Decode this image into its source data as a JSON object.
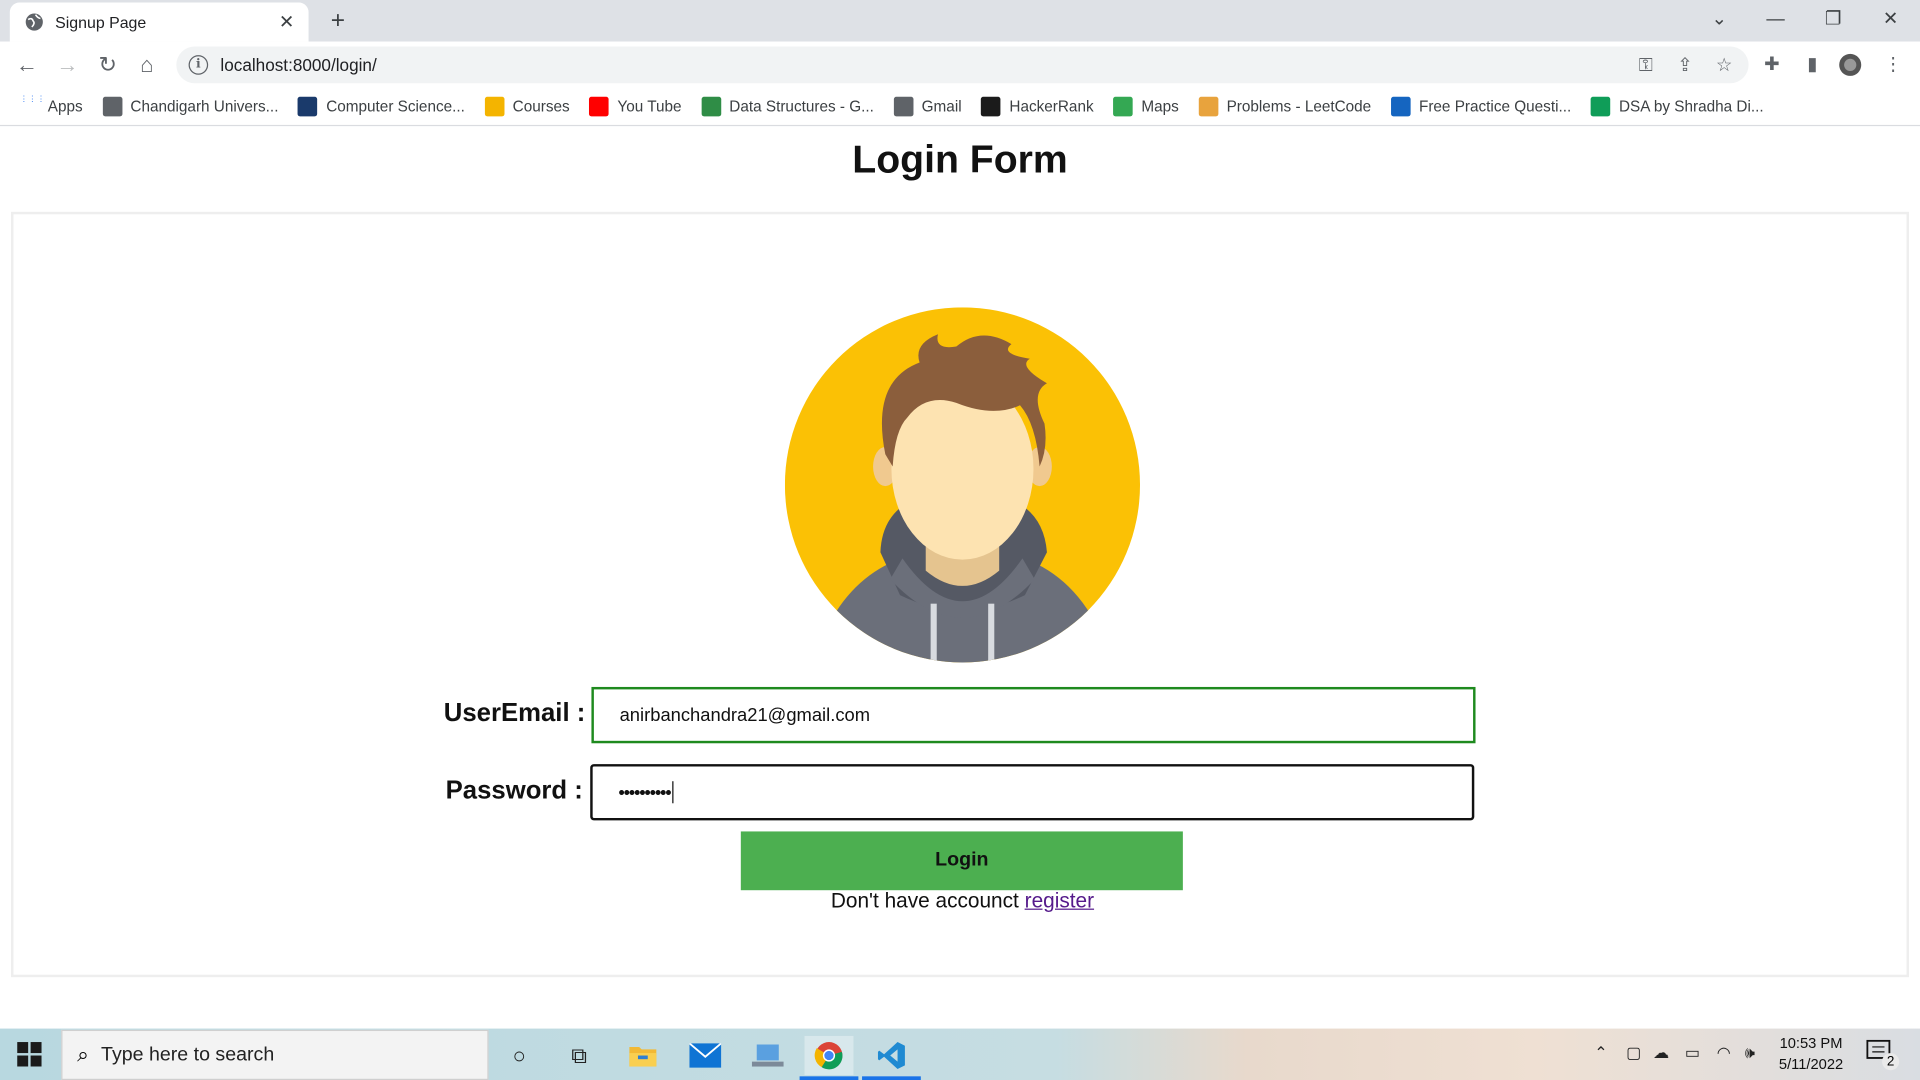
{
  "browser": {
    "tab_title": "Signup Page",
    "url": "localhost:8000/login/",
    "bookmarks": [
      {
        "label": "Apps",
        "color": "#4285f4"
      },
      {
        "label": "Chandigarh Univers...",
        "color": "#5f6368"
      },
      {
        "label": "Computer Science...",
        "color": "#1a3a6b"
      },
      {
        "label": "Courses",
        "color": "#f4b400"
      },
      {
        "label": "You Tube",
        "color": "#ff0000"
      },
      {
        "label": "Data Structures - G...",
        "color": "#2f8d46"
      },
      {
        "label": "Gmail",
        "color": "#5f6368"
      },
      {
        "label": "HackerRank",
        "color": "#1b1b1b"
      },
      {
        "label": "Maps",
        "color": "#34a853"
      },
      {
        "label": "Problems - LeetCode",
        "color": "#e8a33d"
      },
      {
        "label": "Free Practice Questi...",
        "color": "#1565c0"
      },
      {
        "label": "DSA by Shradha Di...",
        "color": "#0f9d58"
      }
    ]
  },
  "page": {
    "title": "Login Form",
    "email_label": "UserEmail :",
    "email_value": "anirbanchandra21@gmail.com",
    "password_label": "Password :",
    "password_value": "••••••••••",
    "login_label": "Login",
    "register_prompt": "Don't have accounct",
    "register_link": "register",
    "button_color": "#4caf50"
  },
  "taskbar": {
    "search_placeholder": "Type here to search",
    "time": "10:53 PM",
    "date": "5/11/2022",
    "notification_count": "2"
  }
}
